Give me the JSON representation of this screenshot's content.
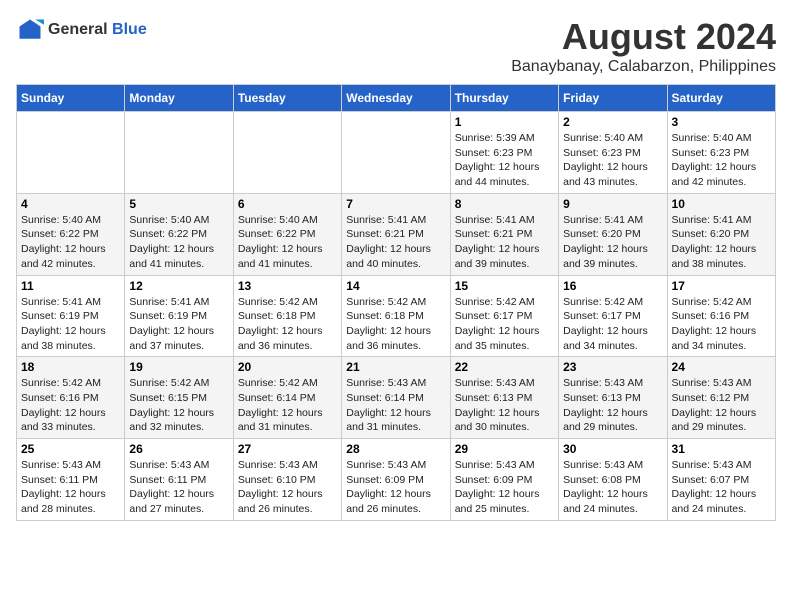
{
  "logo": {
    "general": "General",
    "blue": "Blue"
  },
  "title": "August 2024",
  "subtitle": "Banaybanay, Calabarzon, Philippines",
  "days_of_week": [
    "Sunday",
    "Monday",
    "Tuesday",
    "Wednesday",
    "Thursday",
    "Friday",
    "Saturday"
  ],
  "weeks": [
    [
      {
        "day": "",
        "detail": ""
      },
      {
        "day": "",
        "detail": ""
      },
      {
        "day": "",
        "detail": ""
      },
      {
        "day": "",
        "detail": ""
      },
      {
        "day": "1",
        "detail": "Sunrise: 5:39 AM\nSunset: 6:23 PM\nDaylight: 12 hours\nand 44 minutes."
      },
      {
        "day": "2",
        "detail": "Sunrise: 5:40 AM\nSunset: 6:23 PM\nDaylight: 12 hours\nand 43 minutes."
      },
      {
        "day": "3",
        "detail": "Sunrise: 5:40 AM\nSunset: 6:23 PM\nDaylight: 12 hours\nand 42 minutes."
      }
    ],
    [
      {
        "day": "4",
        "detail": "Sunrise: 5:40 AM\nSunset: 6:22 PM\nDaylight: 12 hours\nand 42 minutes."
      },
      {
        "day": "5",
        "detail": "Sunrise: 5:40 AM\nSunset: 6:22 PM\nDaylight: 12 hours\nand 41 minutes."
      },
      {
        "day": "6",
        "detail": "Sunrise: 5:40 AM\nSunset: 6:22 PM\nDaylight: 12 hours\nand 41 minutes."
      },
      {
        "day": "7",
        "detail": "Sunrise: 5:41 AM\nSunset: 6:21 PM\nDaylight: 12 hours\nand 40 minutes."
      },
      {
        "day": "8",
        "detail": "Sunrise: 5:41 AM\nSunset: 6:21 PM\nDaylight: 12 hours\nand 39 minutes."
      },
      {
        "day": "9",
        "detail": "Sunrise: 5:41 AM\nSunset: 6:20 PM\nDaylight: 12 hours\nand 39 minutes."
      },
      {
        "day": "10",
        "detail": "Sunrise: 5:41 AM\nSunset: 6:20 PM\nDaylight: 12 hours\nand 38 minutes."
      }
    ],
    [
      {
        "day": "11",
        "detail": "Sunrise: 5:41 AM\nSunset: 6:19 PM\nDaylight: 12 hours\nand 38 minutes."
      },
      {
        "day": "12",
        "detail": "Sunrise: 5:41 AM\nSunset: 6:19 PM\nDaylight: 12 hours\nand 37 minutes."
      },
      {
        "day": "13",
        "detail": "Sunrise: 5:42 AM\nSunset: 6:18 PM\nDaylight: 12 hours\nand 36 minutes."
      },
      {
        "day": "14",
        "detail": "Sunrise: 5:42 AM\nSunset: 6:18 PM\nDaylight: 12 hours\nand 36 minutes."
      },
      {
        "day": "15",
        "detail": "Sunrise: 5:42 AM\nSunset: 6:17 PM\nDaylight: 12 hours\nand 35 minutes."
      },
      {
        "day": "16",
        "detail": "Sunrise: 5:42 AM\nSunset: 6:17 PM\nDaylight: 12 hours\nand 34 minutes."
      },
      {
        "day": "17",
        "detail": "Sunrise: 5:42 AM\nSunset: 6:16 PM\nDaylight: 12 hours\nand 34 minutes."
      }
    ],
    [
      {
        "day": "18",
        "detail": "Sunrise: 5:42 AM\nSunset: 6:16 PM\nDaylight: 12 hours\nand 33 minutes."
      },
      {
        "day": "19",
        "detail": "Sunrise: 5:42 AM\nSunset: 6:15 PM\nDaylight: 12 hours\nand 32 minutes."
      },
      {
        "day": "20",
        "detail": "Sunrise: 5:42 AM\nSunset: 6:14 PM\nDaylight: 12 hours\nand 31 minutes."
      },
      {
        "day": "21",
        "detail": "Sunrise: 5:43 AM\nSunset: 6:14 PM\nDaylight: 12 hours\nand 31 minutes."
      },
      {
        "day": "22",
        "detail": "Sunrise: 5:43 AM\nSunset: 6:13 PM\nDaylight: 12 hours\nand 30 minutes."
      },
      {
        "day": "23",
        "detail": "Sunrise: 5:43 AM\nSunset: 6:13 PM\nDaylight: 12 hours\nand 29 minutes."
      },
      {
        "day": "24",
        "detail": "Sunrise: 5:43 AM\nSunset: 6:12 PM\nDaylight: 12 hours\nand 29 minutes."
      }
    ],
    [
      {
        "day": "25",
        "detail": "Sunrise: 5:43 AM\nSunset: 6:11 PM\nDaylight: 12 hours\nand 28 minutes."
      },
      {
        "day": "26",
        "detail": "Sunrise: 5:43 AM\nSunset: 6:11 PM\nDaylight: 12 hours\nand 27 minutes."
      },
      {
        "day": "27",
        "detail": "Sunrise: 5:43 AM\nSunset: 6:10 PM\nDaylight: 12 hours\nand 26 minutes."
      },
      {
        "day": "28",
        "detail": "Sunrise: 5:43 AM\nSunset: 6:09 PM\nDaylight: 12 hours\nand 26 minutes."
      },
      {
        "day": "29",
        "detail": "Sunrise: 5:43 AM\nSunset: 6:09 PM\nDaylight: 12 hours\nand 25 minutes."
      },
      {
        "day": "30",
        "detail": "Sunrise: 5:43 AM\nSunset: 6:08 PM\nDaylight: 12 hours\nand 24 minutes."
      },
      {
        "day": "31",
        "detail": "Sunrise: 5:43 AM\nSunset: 6:07 PM\nDaylight: 12 hours\nand 24 minutes."
      }
    ]
  ]
}
